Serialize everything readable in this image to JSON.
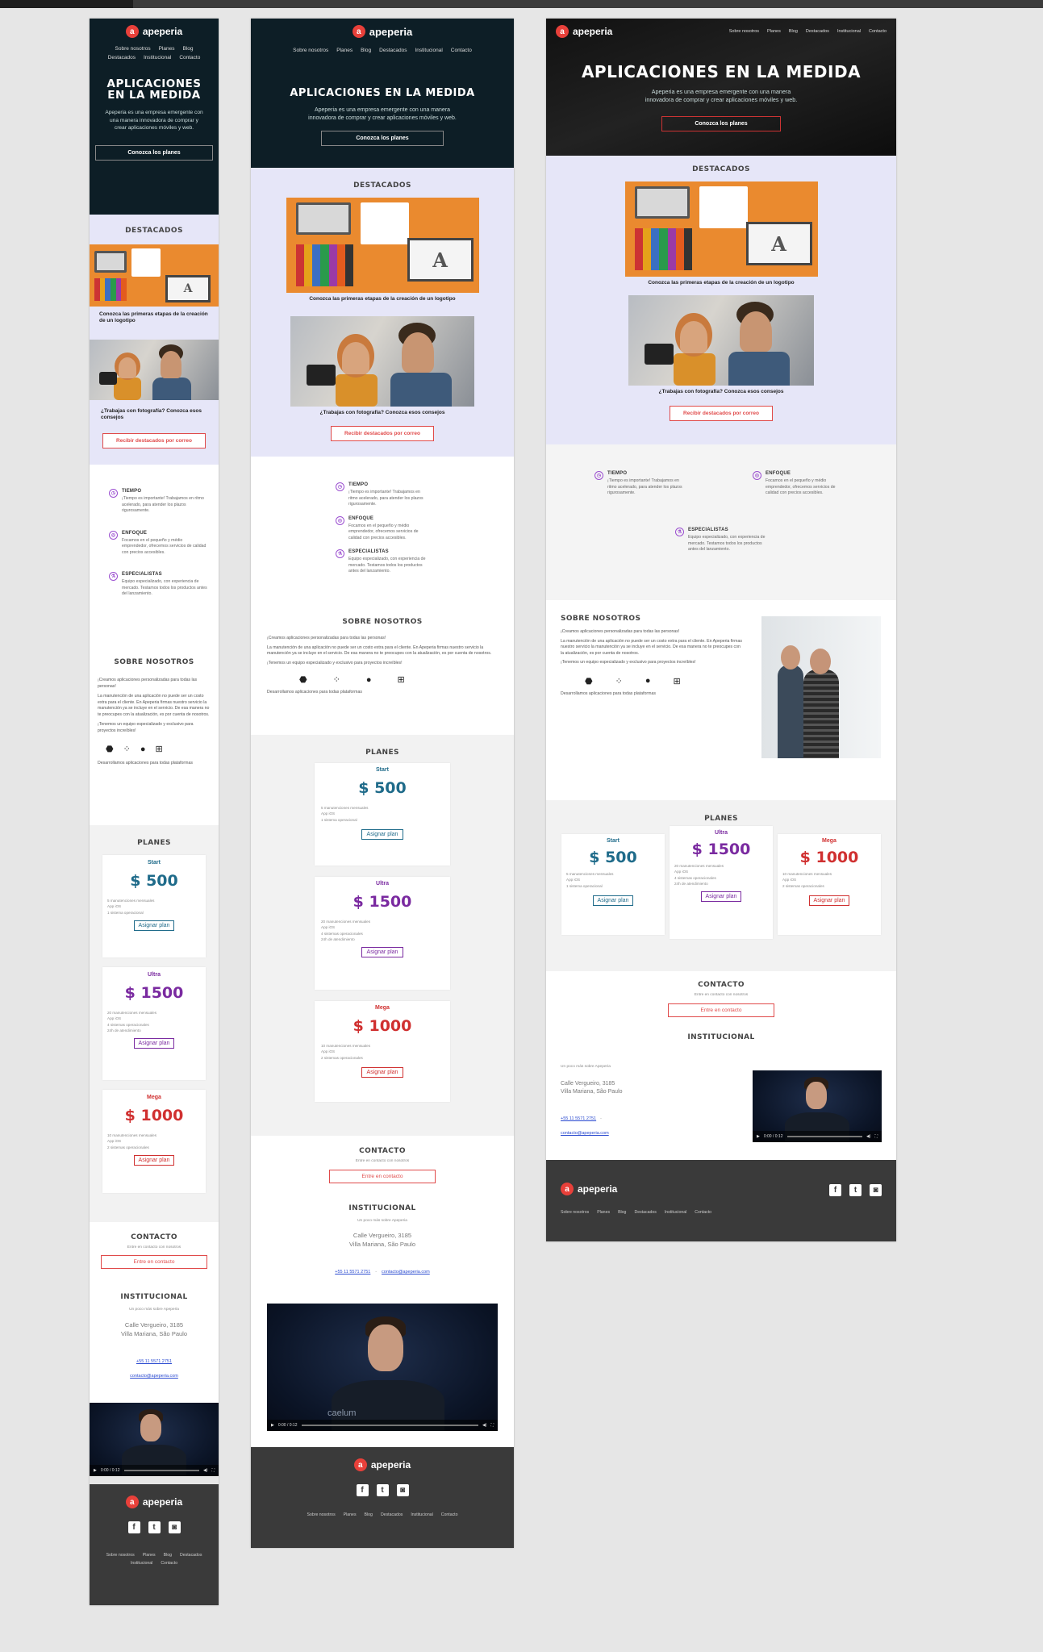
{
  "brand": {
    "name": "apeperia",
    "logo_letter": "a"
  },
  "nav": [
    "Sobre nosotros",
    "Planes",
    "Blog",
    "Destacados",
    "Institucional",
    "Contacto"
  ],
  "hero": {
    "title": "APLICACIONES EN LA MEDIDA",
    "text": "Apeperia es una empresa emergente con una manera innovadora de comprar y crear aplicaciones móviles y web.",
    "button": "Conozca los planes"
  },
  "featured": {
    "title": "DESTACADOS",
    "items": [
      {
        "caption": "Conozca las primeras etapas de la creación de un logotipo"
      },
      {
        "caption": "¿Trabajas con fotografía? Conozca esos consejos"
      }
    ],
    "button": "Recibir destacados por correo"
  },
  "why": [
    {
      "icon": "clock-icon",
      "glyph": "◷",
      "title": "TIEMPO",
      "text": "¡Tiempo es importante! Trabajamos en ritmo acelerado, para atender los plazos rigurosamente."
    },
    {
      "icon": "focus-icon",
      "glyph": "◎",
      "title": "ENFOQUE",
      "text": "Focamos en el pequeño y médio emprendedor, ofrecemos servicios de calidad con precios accesibles."
    },
    {
      "icon": "flask-icon",
      "glyph": "⚗",
      "title": "ESPECIALISTAS",
      "text": "Equipo especializado, con experiencia de mercado. Testamos todos los productos antes del lanzamiento."
    }
  ],
  "about": {
    "title": "SOBRE NOSOTROS",
    "p1": "¡Creamos aplicaciones personalizadas para todas las personas!",
    "p2": "La manutención de una aplicación no puede ser un costo extra para el cliente. En Apeperia firmas nuestro servicio la manutención ya se incluye en el servicio. De esa manera no te preocupes con la atualización, es por cuenta de nosotros.",
    "p3": "¡Tenemos un equipo especializado y exclusivo para proyectos increíbles!",
    "platforms_text": "Desarrollamos aplicaciones para todas plataformas",
    "platforms": [
      {
        "name": "android-icon",
        "glyph": "⬣"
      },
      {
        "name": "blackberry-icon",
        "glyph": "⁘"
      },
      {
        "name": "apple-icon",
        "glyph": "●"
      },
      {
        "name": "windows-icon",
        "glyph": "⊞"
      }
    ]
  },
  "plans": {
    "title": "PLANES",
    "button": "Asignar plan",
    "items": [
      {
        "name": "Start",
        "price": "$ 500",
        "features": [
          "5 manutenciones mensuales",
          "App iOS",
          "1 sistema operacional"
        ]
      },
      {
        "name": "Ultra",
        "price": "$ 1500",
        "features": [
          "20 manutenciones mensuales",
          "App iOS",
          "4 sistemas operacionales",
          "24h de atendimiento"
        ]
      },
      {
        "name": "Mega",
        "price": "$ 1000",
        "features": [
          "10 manutenciones mensuales",
          "App iOS",
          "2 sistemas operacionales"
        ]
      }
    ]
  },
  "contact": {
    "title": "CONTACTO",
    "text": "Entre en contacto con nosotros",
    "button": "Entre en contacto"
  },
  "institutional": {
    "title": "INSTITUCIONAL",
    "text": "Un poco más sobre Apeperia",
    "address1": "Calle Vergueiro, 3185",
    "address2": "Villa Mariana, São Paulo",
    "phone": "+55 11 5571 2751",
    "email": "contacto@apeperia.com",
    "video_time": "0:00 / 0:12",
    "video_brand": "caelum"
  },
  "footer": {
    "social": [
      {
        "name": "facebook-icon",
        "glyph": "f"
      },
      {
        "name": "twitter-icon",
        "glyph": "t"
      },
      {
        "name": "instagram-icon",
        "glyph": "◙"
      }
    ]
  }
}
